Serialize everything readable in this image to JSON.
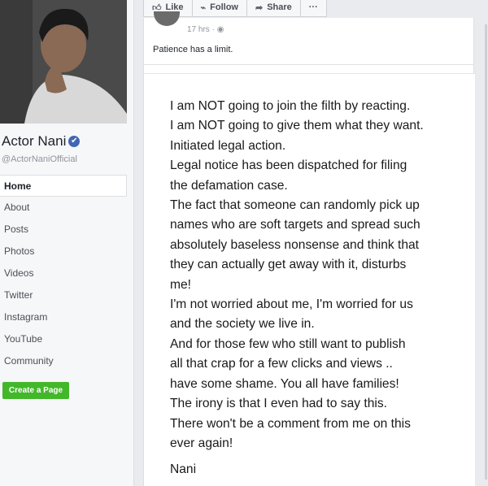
{
  "profile": {
    "name": "Actor Nani",
    "handle": "@ActorNaniOfficial",
    "verified_glyph": "✔"
  },
  "nav": {
    "items": [
      {
        "label": "Home",
        "active": true
      },
      {
        "label": "About"
      },
      {
        "label": "Posts"
      },
      {
        "label": "Photos"
      },
      {
        "label": "Videos"
      },
      {
        "label": "Twitter"
      },
      {
        "label": "Instagram"
      },
      {
        "label": "YouTube"
      },
      {
        "label": "Community"
      }
    ],
    "create_page": "Create a Page"
  },
  "actions": {
    "like": "Like",
    "follow": "Follow",
    "share": "Share",
    "more": "···"
  },
  "post": {
    "time": "17 hrs ·",
    "caption": "Patience has a limit.",
    "note_body": "I am NOT going to join the filth by reacting.\nI am NOT going to give them what they want.\nInitiated legal action.\nLegal notice has been dispatched for filing\nthe defamation case.\nThe fact that someone can randomly pick up\nnames who are soft targets and spread such\nabsolutely baseless nonsense and think that\nthey can actually get away with it, disturbs\nme!\nI'm not worried about me, I'm worried for us\nand the society we live in.\nAnd for those few who still want to publish\nall that crap for a few clicks and views ..\nhave some shame. You all have families!\nThe irony is that I even had to say this.\nThere won't be a comment from me on this\never again!",
    "signature": "Nani"
  },
  "colors": {
    "brand": "#4267b2",
    "create_button": "#42b72a",
    "page_bg": "#e9ebee"
  }
}
